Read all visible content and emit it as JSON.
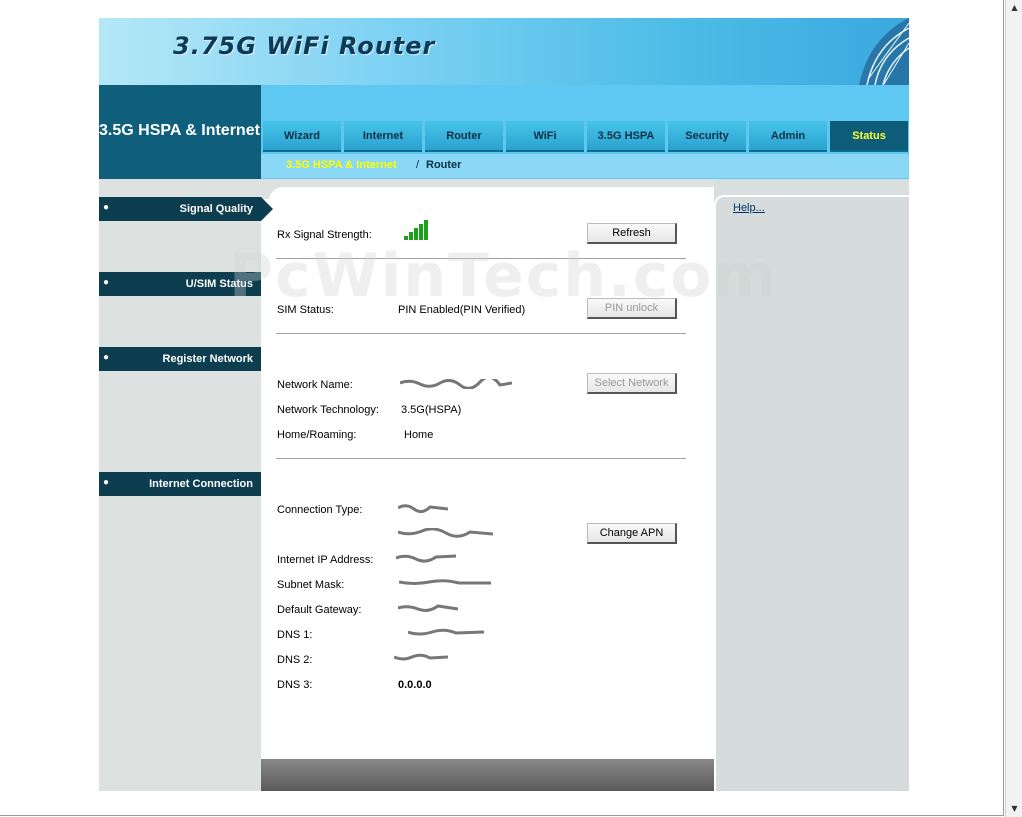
{
  "banner": {
    "title": "3.75G WiFi Router"
  },
  "side_header": "3.5G HSPA & Internet",
  "tabs": [
    {
      "label": "Wizard"
    },
    {
      "label": "Internet"
    },
    {
      "label": "Router"
    },
    {
      "label": "WiFi"
    },
    {
      "label": "3.5G HSPA"
    },
    {
      "label": "Security"
    },
    {
      "label": "Admin"
    },
    {
      "label": "Status"
    }
  ],
  "active_tab": "Status",
  "breadcrumb": {
    "section": "3.5G HSPA & Internet",
    "separator": "/",
    "page": "Router"
  },
  "sidebar": {
    "sections": [
      {
        "label": "Signal Quality"
      },
      {
        "label": "U/SIM Status"
      },
      {
        "label": "Register Network"
      },
      {
        "label": "Internet Connection"
      }
    ]
  },
  "help_link": "Help...",
  "signal": {
    "label": "Rx Signal Strength:",
    "bars": 5,
    "refresh_button": "Refresh"
  },
  "sim": {
    "label": "SIM Status:",
    "value": "PIN Enabled(PIN Verified)",
    "pin_button": "PIN unlock"
  },
  "network": {
    "name_label": "Network Name:",
    "tech_label": "Network Technology:",
    "tech_value": "3.5G(HSPA)",
    "roaming_label": "Home/Roaming:",
    "roaming_value": "Home",
    "select_button": "Select Network"
  },
  "connection": {
    "type_label": "Connection Type:",
    "ip_label": "Internet IP Address:",
    "mask_label": "Subnet Mask:",
    "gateway_label": "Default Gateway:",
    "dns1_label": "DNS 1:",
    "dns2_label": "DNS 2:",
    "dns3_label": "DNS 3:",
    "dns3_value": "0.0.0.0",
    "apn_button": "Change APN"
  },
  "watermark": "PcWinTech.com",
  "colors": {
    "nav_bg": "#5fc8f2",
    "sidebar_dark": "#0c3e50",
    "active_tab_text": "#ffff33"
  }
}
